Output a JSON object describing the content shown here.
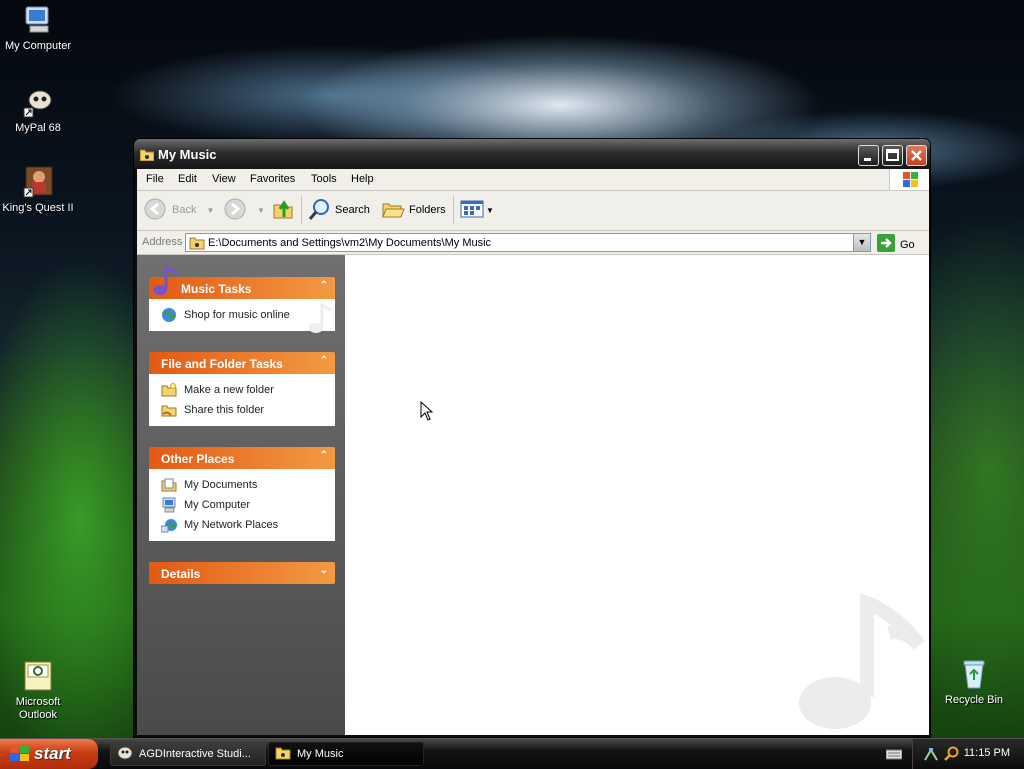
{
  "desktop": {
    "icons": [
      {
        "label": "My Computer",
        "icon": "my-computer-icon"
      },
      {
        "label": "MyPal 68",
        "icon": "mypal-icon"
      },
      {
        "label": "King's Quest II",
        "icon": "kings-quest-icon"
      },
      {
        "label_line1": "Microsoft",
        "label_line2": "Outlook",
        "icon": "outlook-icon"
      },
      {
        "label": "Recycle Bin",
        "icon": "recycle-bin-icon"
      }
    ]
  },
  "window": {
    "title": "My Music",
    "menu": [
      "File",
      "Edit",
      "View",
      "Favorites",
      "Tools",
      "Help"
    ],
    "toolbar": {
      "back": "Back",
      "search": "Search",
      "folders": "Folders"
    },
    "address": {
      "label": "Address",
      "value": "E:\\Documents and Settings\\vm2\\My Documents\\My Music",
      "go": "Go"
    },
    "taskpane": {
      "music_tasks": {
        "title": "Music Tasks",
        "items": [
          "Shop for music online"
        ]
      },
      "file_folder_tasks": {
        "title": "File and Folder Tasks",
        "items": [
          "Make a new folder",
          "Share this folder"
        ]
      },
      "other_places": {
        "title": "Other Places",
        "items": [
          "My Documents",
          "My Computer",
          "My Network Places"
        ]
      },
      "details": {
        "title": "Details"
      }
    }
  },
  "taskbar": {
    "start": "start",
    "tasks": [
      "AGDInteractive Studi...",
      "My Music"
    ],
    "clock": "11:15 PM"
  },
  "colors": {
    "accent_orange": "#e25a14",
    "title_dark": "#151515",
    "close_red": "#c3421e"
  }
}
